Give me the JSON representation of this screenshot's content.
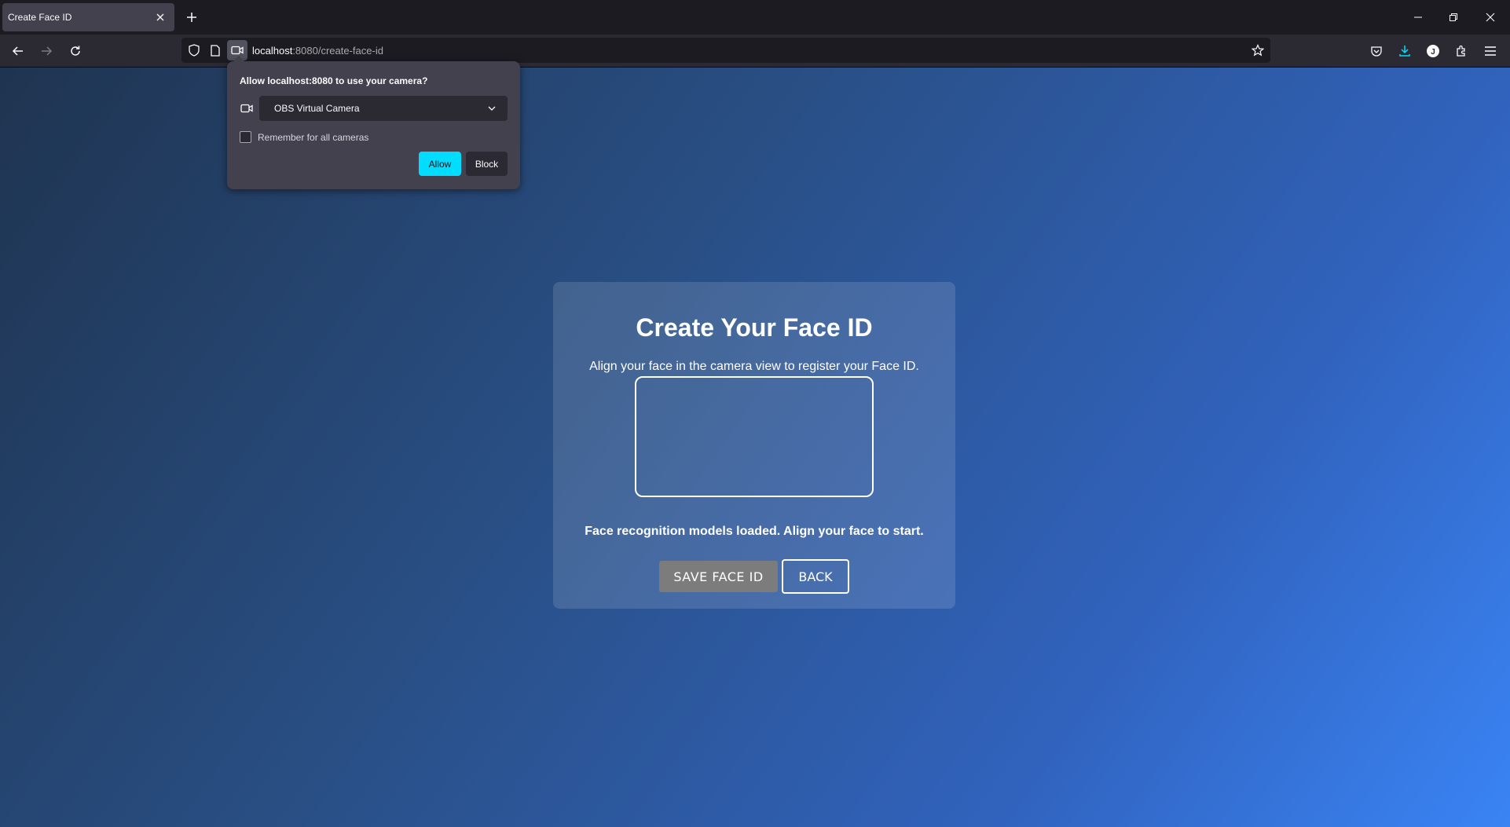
{
  "browser": {
    "tab_title": "Create Face ID",
    "url_host": "localhost",
    "url_rest": ":8080/create-face-id"
  },
  "permission_popup": {
    "title": "Allow localhost:8080 to use your camera?",
    "camera_selected": "OBS Virtual Camera",
    "remember_label": "Remember for all cameras",
    "remember_checked": false,
    "allow_label": "Allow",
    "block_label": "Block"
  },
  "page": {
    "title": "Create Your Face ID",
    "subtitle": "Align your face in the camera view to register your Face ID.",
    "status": "Face recognition models loaded. Align your face to start.",
    "save_label": "SAVE FACE ID",
    "back_label": "BACK"
  },
  "colors": {
    "accent": "#00ddff",
    "save_button": "#7c7c7c",
    "gradient_start": "#1f3450",
    "gradient_end": "#3a84f5"
  },
  "icons": {
    "tab_close": "close-icon",
    "new_tab": "plus-icon",
    "back": "arrow-left-icon",
    "forward": "arrow-right-icon",
    "reload": "reload-icon",
    "tracking": "shield-icon",
    "page_info": "page-icon",
    "camera_permission": "camera-icon",
    "bookmark": "star-icon",
    "pocket": "pocket-icon",
    "downloads": "download-icon",
    "account": "account-icon",
    "extensions": "puzzle-icon",
    "menu": "hamburger-icon"
  }
}
